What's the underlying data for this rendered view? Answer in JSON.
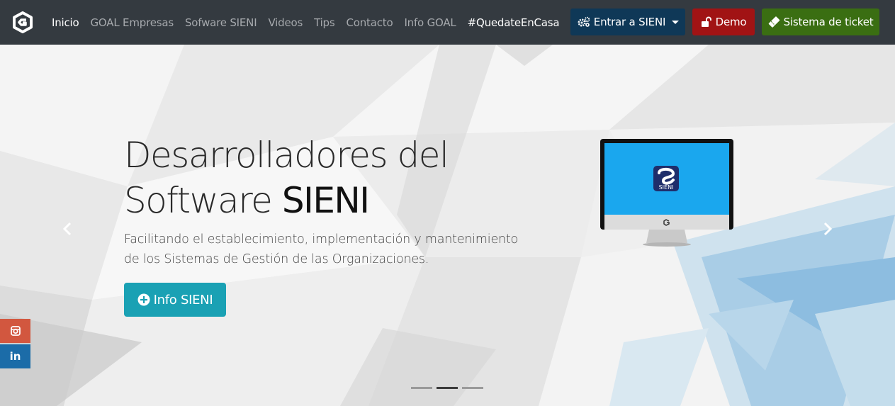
{
  "nav": {
    "links": [
      {
        "label": "Inicio",
        "active": true
      },
      {
        "label": "GOAL Empresas"
      },
      {
        "label": "Sofware SIENI"
      },
      {
        "label": "Videos"
      },
      {
        "label": "Tips"
      },
      {
        "label": "Contacto"
      },
      {
        "label": "Info GOAL"
      },
      {
        "label": "#QuedateEnCasa"
      }
    ],
    "entrar_label": "Entrar a SIENI",
    "demo_label": "Demo",
    "ticket_label": "Sistema de ticket"
  },
  "hero": {
    "headline_line1": "Desarrolladores del",
    "headline_line2_light": "Software",
    "headline_line2_bold": "SIENI",
    "subtitle": "Facilitando el establecimiento, implementación y mantenimiento de los Sistemas de Gestión de las Organizaciones.",
    "cta_label": "Info SIENI",
    "screen_badge": "SIENI",
    "slide_count": 3,
    "active_slide": 2
  },
  "social": {
    "linkedin_label": "in"
  },
  "colors": {
    "navbar": "#343a40",
    "entrar": "#0f3857",
    "demo": "#a11314",
    "ticket": "#3a6e12",
    "cta": "#1aa1b4",
    "instagram": "#d2573f",
    "linkedin": "#1b6ca8"
  }
}
